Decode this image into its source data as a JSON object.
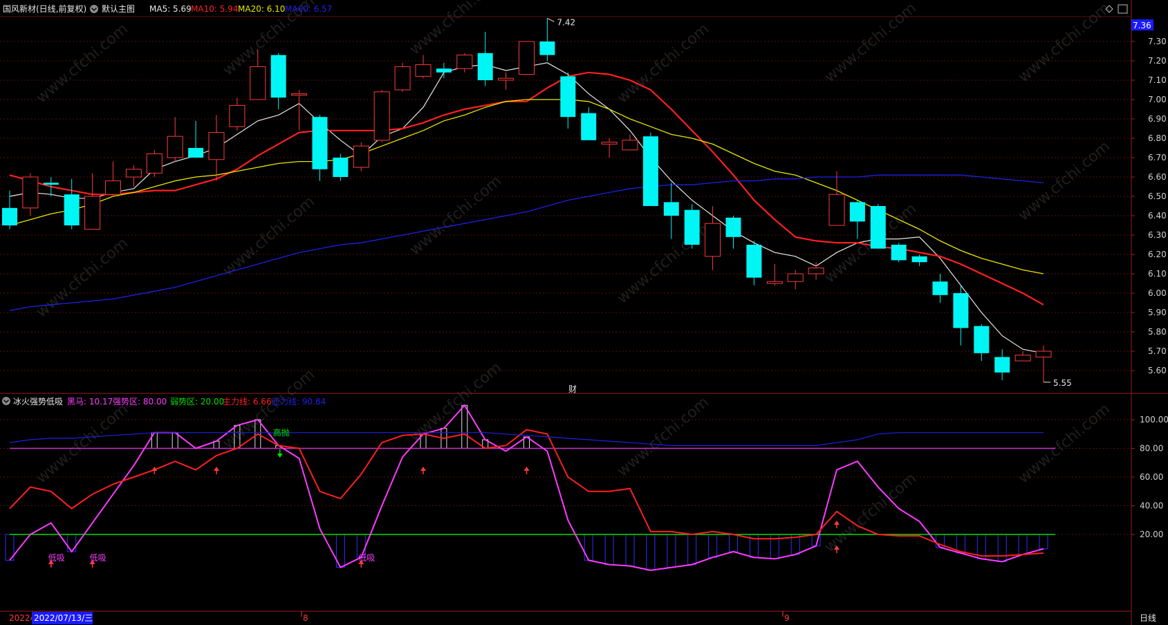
{
  "colors": {
    "bg": "#000000",
    "frame": "#9b1c1c",
    "grid": "#5a1010",
    "up": "#ff3b3b",
    "down": "#00f5f5",
    "ma5": "#e8e8e8",
    "ma10": "#ff2020",
    "ma20": "#e8e800",
    "ma60": "#2020e8",
    "heima": "#ff3cff",
    "zhuli": "#ff2020",
    "yali": "#2020e8",
    "strong": "#cc33cc",
    "weak": "#00e000",
    "volbar": "#3030ff"
  },
  "header": {
    "stock_title": "国风新材(日线,前复权)",
    "indicator_name": "默认主图",
    "legend": [
      {
        "label": "MA5: 5.69",
        "color": "#e8e8e8"
      },
      {
        "label": "MA10: 5.94",
        "color": "#ff2020"
      },
      {
        "label": "MA20: 6.10",
        "color": "#e8e800"
      },
      {
        "label": "MA60: 6.57",
        "color": "#2020e8"
      }
    ]
  },
  "sub_header": {
    "indicator_name": "冰火强势低吸",
    "legend": [
      {
        "label": "黑马: 10.17",
        "color": "#ff3cff"
      },
      {
        "label": "强势区: 80.00",
        "color": "#ff3cff"
      },
      {
        "label": "弱势区: 20.00",
        "color": "#00e000"
      },
      {
        "label": "主力线: 6.66",
        "color": "#ff2020"
      },
      {
        "label": "压力线: 90.84",
        "color": "#2020e8"
      }
    ]
  },
  "price_badge": "7.36",
  "high_label": "7.42",
  "low_label": "5.55",
  "fin_marker": "财",
  "bottom_bar": {
    "date_left": "20224",
    "date_current": "2022/07/13/三",
    "month_8": "8",
    "month_9": "9",
    "period": "日线"
  },
  "watermark_text": "www.cfchi.com",
  "chart_data": [
    {
      "type": "candlestick",
      "title": "国风新材(日线,前复权)",
      "ylim": [
        5.5,
        7.42
      ],
      "y_ticks": [
        "7.30",
        "7.20",
        "7.10",
        "7.00",
        "6.90",
        "6.80",
        "6.70",
        "6.60",
        "6.50",
        "6.40",
        "6.30",
        "6.20",
        "6.10",
        "6.00",
        "5.90",
        "5.80",
        "5.70",
        "5.60"
      ],
      "candles": [
        {
          "o": 6.44,
          "c": 6.35,
          "h": 6.53,
          "l": 6.33
        },
        {
          "o": 6.44,
          "c": 6.6,
          "h": 6.62,
          "l": 6.4
        },
        {
          "o": 6.57,
          "c": 6.56,
          "h": 6.6,
          "l": 6.5
        },
        {
          "o": 6.51,
          "c": 6.35,
          "h": 6.59,
          "l": 6.33
        },
        {
          "o": 6.33,
          "c": 6.5,
          "h": 6.62,
          "l": 6.33
        },
        {
          "o": 6.51,
          "c": 6.58,
          "h": 6.68,
          "l": 6.5
        },
        {
          "o": 6.6,
          "c": 6.64,
          "h": 6.66,
          "l": 6.55
        },
        {
          "o": 6.62,
          "c": 6.72,
          "h": 6.74,
          "l": 6.6
        },
        {
          "o": 6.7,
          "c": 6.81,
          "h": 6.91,
          "l": 6.68
        },
        {
          "o": 6.75,
          "c": 6.7,
          "h": 6.89,
          "l": 6.7
        },
        {
          "o": 6.69,
          "c": 6.83,
          "h": 6.92,
          "l": 6.58
        },
        {
          "o": 6.86,
          "c": 6.97,
          "h": 7.01,
          "l": 6.84
        },
        {
          "o": 7.0,
          "c": 7.17,
          "h": 7.26,
          "l": 7.0
        },
        {
          "o": 7.23,
          "c": 7.01,
          "h": 7.24,
          "l": 6.95
        },
        {
          "o": 7.03,
          "c": 7.03,
          "h": 7.05,
          "l": 6.84
        },
        {
          "o": 6.91,
          "c": 6.64,
          "h": 6.92,
          "l": 6.58
        },
        {
          "o": 6.7,
          "c": 6.6,
          "h": 6.72,
          "l": 6.58
        },
        {
          "o": 6.65,
          "c": 6.76,
          "h": 6.78,
          "l": 6.63
        },
        {
          "o": 6.79,
          "c": 7.04,
          "h": 7.05,
          "l": 6.78
        },
        {
          "o": 7.05,
          "c": 7.17,
          "h": 7.19,
          "l": 7.04
        },
        {
          "o": 7.12,
          "c": 7.18,
          "h": 7.23,
          "l": 7.11
        },
        {
          "o": 7.16,
          "c": 7.14,
          "h": 7.19,
          "l": 7.11
        },
        {
          "o": 7.16,
          "c": 7.23,
          "h": 7.24,
          "l": 7.14
        },
        {
          "o": 7.24,
          "c": 7.1,
          "h": 7.35,
          "l": 7.07
        },
        {
          "o": 7.1,
          "c": 7.11,
          "h": 7.14,
          "l": 7.05
        },
        {
          "o": 7.13,
          "c": 7.3,
          "h": 7.3,
          "l": 7.13
        },
        {
          "o": 7.3,
          "c": 7.23,
          "h": 7.42,
          "l": 7.2
        },
        {
          "o": 7.12,
          "c": 6.91,
          "h": 7.14,
          "l": 6.85
        },
        {
          "o": 6.93,
          "c": 6.79,
          "h": 6.96,
          "l": 6.79
        },
        {
          "o": 6.77,
          "c": 6.78,
          "h": 6.8,
          "l": 6.7
        },
        {
          "o": 6.74,
          "c": 6.79,
          "h": 6.82,
          "l": 6.74
        },
        {
          "o": 6.81,
          "c": 6.45,
          "h": 6.83,
          "l": 6.45
        },
        {
          "o": 6.47,
          "c": 6.4,
          "h": 6.57,
          "l": 6.28
        },
        {
          "o": 6.43,
          "c": 6.25,
          "h": 6.46,
          "l": 6.23
        },
        {
          "o": 6.19,
          "c": 6.36,
          "h": 6.45,
          "l": 6.12
        },
        {
          "o": 6.39,
          "c": 6.29,
          "h": 6.4,
          "l": 6.23
        },
        {
          "o": 6.25,
          "c": 6.08,
          "h": 6.27,
          "l": 6.04
        },
        {
          "o": 6.05,
          "c": 6.06,
          "h": 6.15,
          "l": 6.04
        },
        {
          "o": 6.06,
          "c": 6.1,
          "h": 6.12,
          "l": 6.02
        },
        {
          "o": 6.1,
          "c": 6.13,
          "h": 6.16,
          "l": 6.07
        },
        {
          "o": 6.35,
          "c": 6.51,
          "h": 6.63,
          "l": 6.35
        },
        {
          "o": 6.47,
          "c": 6.37,
          "h": 6.48,
          "l": 6.28
        },
        {
          "o": 6.45,
          "c": 6.23,
          "h": 6.46,
          "l": 6.23
        },
        {
          "o": 6.25,
          "c": 6.17,
          "h": 6.26,
          "l": 6.16
        },
        {
          "o": 6.19,
          "c": 6.16,
          "h": 6.2,
          "l": 6.14
        },
        {
          "o": 6.06,
          "c": 5.99,
          "h": 6.1,
          "l": 5.95
        },
        {
          "o": 6.0,
          "c": 5.82,
          "h": 6.04,
          "l": 5.73
        },
        {
          "o": 5.83,
          "c": 5.69,
          "h": 5.84,
          "l": 5.65
        },
        {
          "o": 5.67,
          "c": 5.59,
          "h": 5.71,
          "l": 5.55
        },
        {
          "o": 5.65,
          "c": 5.68,
          "h": 5.7,
          "l": 5.65
        },
        {
          "o": 5.67,
          "c": 5.7,
          "h": 5.73,
          "l": 5.54
        }
      ],
      "series": [
        {
          "name": "MA5",
          "values": [
            6.5,
            6.52,
            6.51,
            6.49,
            6.49,
            6.52,
            6.54,
            6.64,
            6.68,
            6.71,
            6.75,
            6.82,
            6.89,
            6.92,
            6.98,
            6.88,
            6.79,
            6.71,
            6.81,
            6.85,
            6.96,
            7.14,
            7.17,
            7.18,
            7.15,
            7.17,
            7.19,
            7.13,
            7.03,
            6.95,
            6.84,
            6.7,
            6.58,
            6.48,
            6.4,
            6.32,
            6.26,
            6.21,
            6.19,
            6.14,
            6.21,
            6.26,
            6.28,
            6.28,
            6.29,
            6.18,
            6.04,
            5.9,
            5.78,
            5.71,
            5.69
          ]
        },
        {
          "name": "MA10",
          "values": [
            6.61,
            6.58,
            6.55,
            6.53,
            6.51,
            6.51,
            6.52,
            6.53,
            6.53,
            6.56,
            6.59,
            6.64,
            6.71,
            6.77,
            6.83,
            6.84,
            6.84,
            6.84,
            6.84,
            6.85,
            6.88,
            6.92,
            6.95,
            6.97,
            6.99,
            6.99,
            7.06,
            7.12,
            7.14,
            7.13,
            7.1,
            7.05,
            6.95,
            6.84,
            6.73,
            6.61,
            6.48,
            6.38,
            6.29,
            6.27,
            6.26,
            6.26,
            6.24,
            6.23,
            6.21,
            6.19,
            6.15,
            6.1,
            6.05,
            6.0,
            5.94
          ]
        },
        {
          "name": "MA20",
          "values": [
            6.35,
            6.38,
            6.41,
            6.43,
            6.46,
            6.5,
            6.52,
            6.55,
            6.58,
            6.6,
            6.61,
            6.63,
            6.65,
            6.67,
            6.68,
            6.68,
            6.69,
            6.72,
            6.76,
            6.8,
            6.84,
            6.89,
            6.92,
            6.96,
            6.99,
            7.0,
            7.0,
            7.0,
            6.99,
            6.95,
            6.9,
            6.86,
            6.82,
            6.8,
            6.77,
            6.72,
            6.67,
            6.63,
            6.61,
            6.57,
            6.53,
            6.48,
            6.43,
            6.38,
            6.33,
            6.27,
            6.22,
            6.18,
            6.15,
            6.12,
            6.1
          ]
        },
        {
          "name": "MA60",
          "values": [
            5.91,
            5.93,
            5.94,
            5.95,
            5.96,
            5.97,
            5.99,
            6.01,
            6.03,
            6.06,
            6.09,
            6.12,
            6.15,
            6.18,
            6.21,
            6.23,
            6.25,
            6.26,
            6.28,
            6.3,
            6.32,
            6.34,
            6.36,
            6.38,
            6.4,
            6.42,
            6.45,
            6.48,
            6.5,
            6.52,
            6.54,
            6.55,
            6.56,
            6.56,
            6.57,
            6.58,
            6.58,
            6.59,
            6.59,
            6.6,
            6.6,
            6.6,
            6.61,
            6.61,
            6.61,
            6.61,
            6.61,
            6.6,
            6.59,
            6.58,
            6.57
          ]
        }
      ]
    },
    {
      "type": "line",
      "title": "冰火强势低吸",
      "ylim": [
        -10,
        120
      ],
      "y_ticks": [
        "100.00",
        "80.00",
        "60.00",
        "40.00",
        "20.00"
      ],
      "series": [
        {
          "name": "黑马",
          "values": [
            2,
            20,
            28,
            8,
            28,
            48,
            68,
            91,
            91,
            80,
            85,
            96,
            100,
            82,
            73,
            24,
            -3,
            4,
            40,
            74,
            90,
            94,
            110,
            86,
            78,
            88,
            78,
            30,
            2,
            -1,
            -2,
            -5,
            -3,
            -1,
            4,
            8,
            4,
            3,
            6,
            12,
            65,
            71,
            53,
            38,
            29,
            11,
            7,
            3,
            1,
            6,
            10
          ]
        },
        {
          "name": "主力线",
          "values": [
            38,
            53,
            50,
            38,
            48,
            55,
            60,
            65,
            71,
            65,
            75,
            80,
            90,
            82,
            80,
            50,
            45,
            62,
            84,
            89,
            90,
            87,
            90,
            80,
            82,
            93,
            90,
            60,
            50,
            50,
            52,
            22,
            22,
            20,
            22,
            20,
            17,
            17,
            18,
            20,
            36,
            26,
            20,
            19,
            19,
            13,
            8,
            5,
            5,
            6,
            7
          ]
        },
        {
          "name": "压力线",
          "values": [
            84,
            86,
            87,
            87,
            88,
            89,
            90,
            91,
            91,
            91,
            91,
            91,
            91,
            91,
            91,
            91,
            91,
            91,
            91,
            91,
            91,
            91,
            91,
            91,
            90,
            89,
            88,
            87,
            86,
            85,
            84,
            83,
            82,
            82,
            82,
            82,
            82,
            82,
            82,
            82,
            84,
            86,
            90,
            91,
            91,
            91,
            91,
            91,
            91,
            91,
            91
          ]
        }
      ],
      "strong_zone": 80,
      "weak_zone": 20,
      "annotations": [
        "高抛",
        "低吸",
        "低吸",
        "低吸"
      ]
    }
  ]
}
